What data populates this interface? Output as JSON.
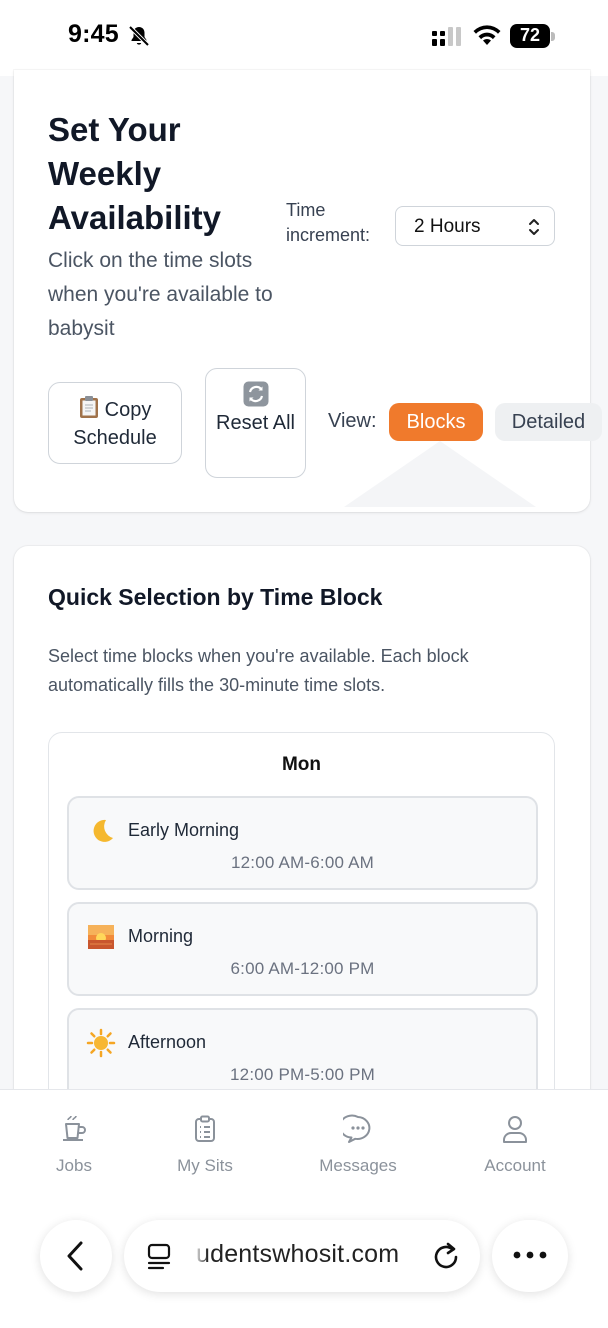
{
  "status_bar": {
    "time": "9:45",
    "battery": "72",
    "icons": [
      "bell-slash-icon",
      "cellular-signal-icon",
      "wifi-icon",
      "battery-icon"
    ]
  },
  "availability": {
    "title": "Set Your Weekly Availability",
    "subtitle": "Click on the time slots when you're available to babysit",
    "increment_label": "Time increment:",
    "increment_value": "2 Hours",
    "copy_label": "Copy Schedule",
    "reset_label": "Reset All",
    "view_label": "View:",
    "view_options": [
      "Blocks",
      "Detailed"
    ],
    "view_selected": "Blocks"
  },
  "quick_selection": {
    "title": "Quick Selection by Time Block",
    "description": "Select time blocks when you're available. Each block automatically fills the 30-minute time slots.",
    "day": "Mon",
    "blocks": [
      {
        "label": "Early Morning",
        "time": "12:00 AM-6:00 AM",
        "icon": "crescent-moon-icon"
      },
      {
        "label": "Morning",
        "time": "6:00 AM-12:00 PM",
        "icon": "sunrise-icon"
      },
      {
        "label": "Afternoon",
        "time": "12:00 PM-5:00 PM",
        "icon": "sun-icon"
      }
    ]
  },
  "bottom_nav": {
    "items": [
      {
        "label": "Jobs",
        "icon": "cup-icon"
      },
      {
        "label": "My Sits",
        "icon": "clipboard-icon"
      },
      {
        "label": "Messages",
        "icon": "chat-bubble-icon"
      },
      {
        "label": "Account",
        "icon": "person-icon"
      }
    ]
  },
  "browser": {
    "url": "udentswhosit.com",
    "icons": [
      "back-chevron-icon",
      "tabs-icon",
      "reload-icon",
      "more-icon"
    ]
  },
  "colors": {
    "accent": "#f07a2c",
    "nav_text": "#8b929b"
  }
}
